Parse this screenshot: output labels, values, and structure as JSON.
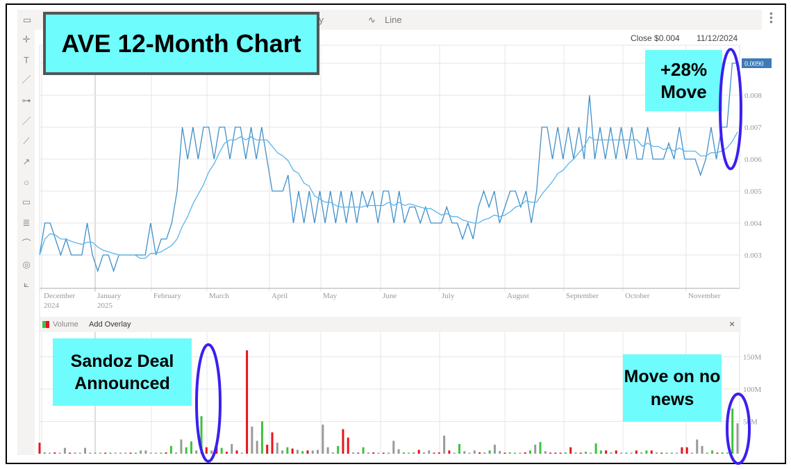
{
  "toolbar": {
    "interval": "Daily",
    "chart_type": "Line"
  },
  "header": {
    "close": "Close $0.004",
    "date": "11/12/2024"
  },
  "last_price_label": "0.0090",
  "volume_panel": {
    "label": "Volume",
    "add_overlay": "Add Overlay",
    "close": "×"
  },
  "annotations": {
    "title": "AVE 12-Month Chart",
    "move": "+28% Move",
    "sandoz": "Sandoz Deal Announced",
    "no_news": "Move on no news"
  },
  "colors": {
    "price": "#3f8fc9",
    "ma": "#5ab4ea",
    "up": "#3ec13e",
    "down": "#e8121a",
    "flat": "#999999",
    "annotation": "#6ffcfc",
    "circle": "#3a1ff0",
    "price_tag": "#3d7ab8"
  },
  "chart_data": [
    {
      "type": "line",
      "title": "AVE 12-Month Chart",
      "x_ticks": [
        [
          "December",
          "2024"
        ],
        [
          "January",
          "2025"
        ],
        [
          "February",
          ""
        ],
        [
          "March",
          ""
        ],
        [
          "April",
          ""
        ],
        [
          "May",
          ""
        ],
        [
          "June",
          ""
        ],
        [
          "July",
          ""
        ],
        [
          "August",
          ""
        ],
        [
          "September",
          ""
        ],
        [
          "October",
          ""
        ],
        [
          "November",
          ""
        ]
      ],
      "y_ticks": [
        "0.003",
        "0.004",
        "0.005",
        "0.006",
        "0.007",
        "0.008"
      ],
      "ylim": [
        0.002,
        0.0105
      ],
      "series": [
        {
          "values": [
            0.003,
            0.004,
            0.004,
            0.0035,
            0.003,
            0.0035,
            0.003,
            0.003,
            0.003,
            0.004,
            0.003,
            0.0025,
            0.003,
            0.003,
            0.0025,
            0.003,
            0.003,
            0.003,
            0.003,
            0.003,
            0.003,
            0.004,
            0.003,
            0.0035,
            0.0035,
            0.004,
            0.005,
            0.007,
            0.006,
            0.007,
            0.006,
            0.007,
            0.007,
            0.006,
            0.007,
            0.007,
            0.006,
            0.007,
            0.007,
            0.006,
            0.007,
            0.006,
            0.007,
            0.006,
            0.005,
            0.005,
            0.005,
            0.0055,
            0.004,
            0.005,
            0.004,
            0.005,
            0.004,
            0.005,
            0.004,
            0.005,
            0.004,
            0.005,
            0.004,
            0.005,
            0.004,
            0.005,
            0.0045,
            0.005,
            0.004,
            0.005,
            0.005,
            0.004,
            0.005,
            0.004,
            0.0045,
            0.0045,
            0.004,
            0.0045,
            0.004,
            0.004,
            0.004,
            0.0045,
            0.004,
            0.004,
            0.0035,
            0.004,
            0.0035,
            0.0045,
            0.005,
            0.0045,
            0.005,
            0.004,
            0.0045,
            0.005,
            0.005,
            0.0045,
            0.005,
            0.004,
            0.005,
            0.007,
            0.007,
            0.006,
            0.007,
            0.006,
            0.007,
            0.006,
            0.007,
            0.006,
            0.008,
            0.006,
            0.007,
            0.006,
            0.007,
            0.006,
            0.007,
            0.006,
            0.007,
            0.006,
            0.006,
            0.007,
            0.006,
            0.006,
            0.006,
            0.0065,
            0.006,
            0.007,
            0.006,
            0.006,
            0.006,
            0.0055,
            0.006,
            0.007,
            0.006,
            0.007,
            0.007,
            0.009,
            0.009
          ]
        }
      ]
    },
    {
      "type": "bar",
      "title": "Volume",
      "y_ticks": [
        "50M",
        "100M",
        "150M"
      ],
      "ylim": [
        0,
        190
      ],
      "values": [
        [
          17,
          "r"
        ],
        [
          2,
          "g"
        ],
        [
          1,
          "n"
        ],
        [
          2,
          "r"
        ],
        [
          1,
          "n"
        ],
        [
          9,
          "n"
        ],
        [
          1,
          "r"
        ],
        [
          2,
          "n"
        ],
        [
          1,
          "n"
        ],
        [
          9,
          "n"
        ],
        [
          1,
          "n"
        ],
        [
          1,
          "g"
        ],
        [
          1,
          "n"
        ],
        [
          1,
          "r"
        ],
        [
          1,
          "g"
        ],
        [
          1,
          "n"
        ],
        [
          1,
          "n"
        ],
        [
          1,
          "n"
        ],
        [
          1,
          "r"
        ],
        [
          1,
          "g"
        ],
        [
          5,
          "n"
        ],
        [
          5,
          "n"
        ],
        [
          1,
          "n"
        ],
        [
          1,
          "n"
        ],
        [
          1,
          "g"
        ],
        [
          2,
          "r"
        ],
        [
          12,
          "g"
        ],
        [
          2,
          "n"
        ],
        [
          22,
          "n"
        ],
        [
          10,
          "g"
        ],
        [
          19,
          "g"
        ],
        [
          5,
          "n"
        ],
        [
          58,
          "g"
        ],
        [
          10,
          "r"
        ],
        [
          5,
          "n"
        ],
        [
          14,
          "r"
        ],
        [
          9,
          "g"
        ],
        [
          3,
          "r"
        ],
        [
          15,
          "n"
        ],
        [
          5,
          "r"
        ],
        [
          1,
          "n"
        ],
        [
          160,
          "r"
        ],
        [
          42,
          "n"
        ],
        [
          20,
          "n"
        ],
        [
          50,
          "g"
        ],
        [
          14,
          "r"
        ],
        [
          33,
          "r"
        ],
        [
          17,
          "n"
        ],
        [
          5,
          "n"
        ],
        [
          10,
          "g"
        ],
        [
          8,
          "r"
        ],
        [
          6,
          "n"
        ],
        [
          4,
          "g"
        ],
        [
          5,
          "r"
        ],
        [
          5,
          "n"
        ],
        [
          6,
          "n"
        ],
        [
          45,
          "n"
        ],
        [
          10,
          "n"
        ],
        [
          2,
          "n"
        ],
        [
          12,
          "g"
        ],
        [
          38,
          "r"
        ],
        [
          25,
          "r"
        ],
        [
          2,
          "n"
        ],
        [
          1,
          "r"
        ],
        [
          10,
          "g"
        ],
        [
          2,
          "n"
        ],
        [
          2,
          "r"
        ],
        [
          1,
          "n"
        ],
        [
          1,
          "r"
        ],
        [
          1,
          "g"
        ],
        [
          20,
          "n"
        ],
        [
          7,
          "n"
        ],
        [
          2,
          "g"
        ],
        [
          1,
          "n"
        ],
        [
          2,
          "g"
        ],
        [
          6,
          "r"
        ],
        [
          2,
          "n"
        ],
        [
          5,
          "n"
        ],
        [
          1,
          "r"
        ],
        [
          2,
          "r"
        ],
        [
          28,
          "n"
        ],
        [
          5,
          "r"
        ],
        [
          1,
          "n"
        ],
        [
          15,
          "g"
        ],
        [
          4,
          "n"
        ],
        [
          1,
          "n"
        ],
        [
          5,
          "n"
        ],
        [
          2,
          "r"
        ],
        [
          2,
          "n"
        ],
        [
          5,
          "g"
        ],
        [
          14,
          "n"
        ],
        [
          4,
          "n"
        ],
        [
          1,
          "r"
        ],
        [
          2,
          "g"
        ],
        [
          1,
          "g"
        ],
        [
          1,
          "n"
        ],
        [
          2,
          "r"
        ],
        [
          5,
          "g"
        ],
        [
          14,
          "n"
        ],
        [
          18,
          "g"
        ],
        [
          4,
          "n"
        ],
        [
          1,
          "r"
        ],
        [
          1,
          "r"
        ],
        [
          1,
          "r"
        ],
        [
          2,
          "g"
        ],
        [
          10,
          "r"
        ],
        [
          2,
          "n"
        ],
        [
          1,
          "r"
        ],
        [
          3,
          "g"
        ],
        [
          1,
          "n"
        ],
        [
          16,
          "g"
        ],
        [
          5,
          "g"
        ],
        [
          5,
          "r"
        ],
        [
          2,
          "n"
        ],
        [
          5,
          "r"
        ],
        [
          1,
          "n"
        ],
        [
          1,
          "g"
        ],
        [
          1,
          "n"
        ],
        [
          5,
          "r"
        ],
        [
          2,
          "n"
        ],
        [
          5,
          "g"
        ],
        [
          5,
          "r"
        ],
        [
          2,
          "n"
        ],
        [
          1,
          "r"
        ],
        [
          1,
          "g"
        ],
        [
          1,
          "g"
        ],
        [
          1,
          "n"
        ],
        [
          10,
          "r"
        ],
        [
          10,
          "r"
        ],
        [
          1,
          "n"
        ],
        [
          22,
          "n"
        ],
        [
          12,
          "n"
        ],
        [
          1,
          "g"
        ],
        [
          5,
          "g"
        ],
        [
          1,
          "r"
        ],
        [
          2,
          "g"
        ],
        [
          1,
          "g"
        ],
        [
          70,
          "g"
        ],
        [
          47,
          "n"
        ]
      ]
    }
  ]
}
